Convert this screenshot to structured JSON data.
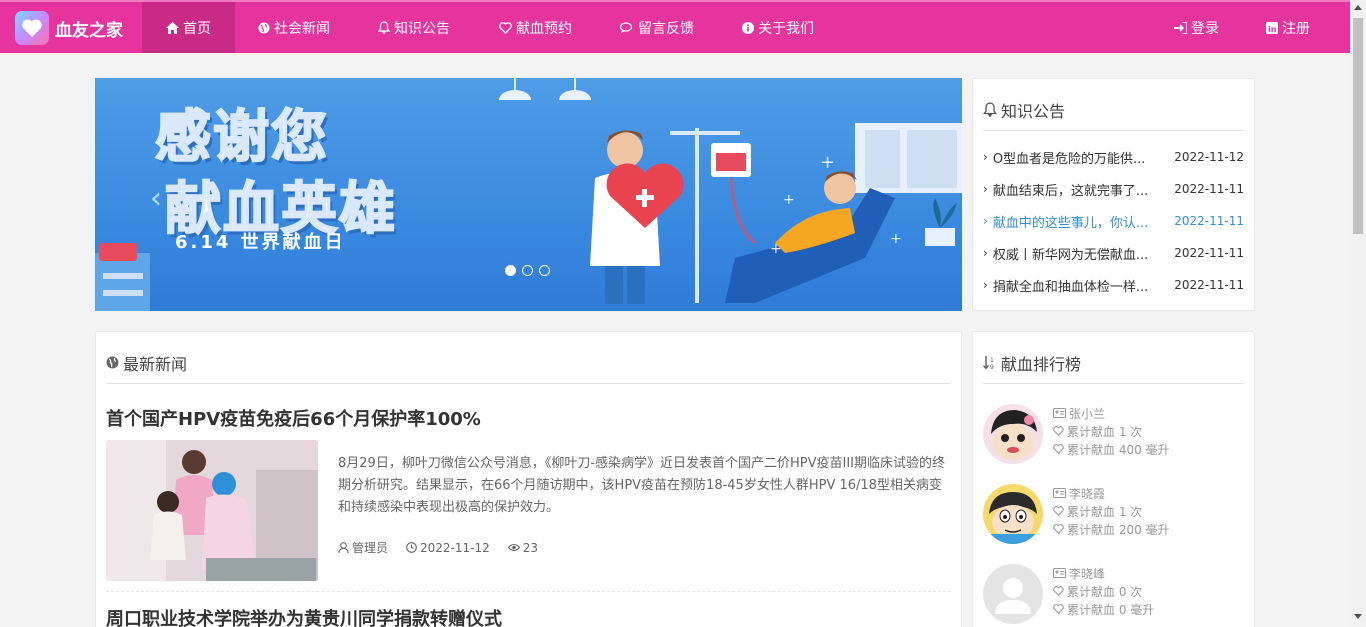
{
  "brand": {
    "name": "血友之家"
  },
  "nav": {
    "items": [
      {
        "label": "首页",
        "icon": "home-icon"
      },
      {
        "label": "社会新闻",
        "icon": "globe-icon"
      },
      {
        "label": "知识公告",
        "icon": "bell-icon"
      },
      {
        "label": "献血预约",
        "icon": "heart-icon"
      },
      {
        "label": "留言反馈",
        "icon": "comments-icon"
      },
      {
        "label": "关于我们",
        "icon": "info-icon"
      }
    ],
    "login": "登录",
    "register": "注册"
  },
  "banner": {
    "title_line1": "感谢您",
    "title_line2": "献血英雄",
    "subtitle": "6.14 世界献血日"
  },
  "notices": {
    "title": "知识公告",
    "items": [
      {
        "title": "O型血者是危险的万能供...",
        "date": "2022-11-12"
      },
      {
        "title": "献血结束后，这就完事了...",
        "date": "2022-11-11"
      },
      {
        "title": "献血中的这些事儿，你认...",
        "date": "2022-11-11"
      },
      {
        "title": "权威丨新华网为无偿献血...",
        "date": "2022-11-11"
      },
      {
        "title": "捐献全血和抽血体检一样...",
        "date": "2022-11-11"
      }
    ]
  },
  "news": {
    "title": "最新新闻",
    "items": [
      {
        "title": "首个国产HPV疫苗免疫后66个月保护率100%",
        "summary": "8月29日，柳叶刀微信公众号消息，《柳叶刀-感染病学》近日发表首个国产二价HPV疫苗III期临床试验的终期分析研究。结果显示，在66个月随访期中，该HPV疫苗在预防18-45岁女性人群HPV 16/18型相关病变和持续感染中表现出极高的保护效力。",
        "author": "管理员",
        "date": "2022-11-12",
        "views": "23"
      },
      {
        "title": "周口职业技术学院举办为黄贵川同学捐款转赠仪式"
      }
    ]
  },
  "ranking": {
    "title": "献血排行榜",
    "items": [
      {
        "name": "张小兰",
        "times": "累计献血 1 次",
        "volume": "累计献血 400 毫升"
      },
      {
        "name": "李晓霞",
        "times": "累计献血 1 次",
        "volume": "累计献血 200 毫升"
      },
      {
        "name": "李晓峰",
        "times": "累计献血 0 次",
        "volume": "累计献血 0 毫升"
      }
    ]
  },
  "colors": {
    "nav_bg": "#e6349e",
    "nav_active": "#c82a85",
    "link_highlight": "#2f8fd8"
  }
}
